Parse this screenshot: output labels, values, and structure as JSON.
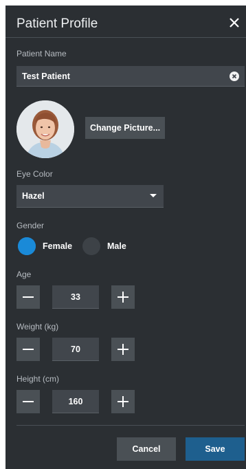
{
  "dialog": {
    "title": "Patient Profile",
    "close_icon": "close-icon"
  },
  "patient_name": {
    "label": "Patient Name",
    "value": "Test Patient",
    "clear_icon": "clear-circle-icon"
  },
  "picture": {
    "change_label": "Change Picture..."
  },
  "eye_color": {
    "label": "Eye Color",
    "selected": "Hazel"
  },
  "gender": {
    "label": "Gender",
    "options": [
      {
        "label": "Female",
        "selected": true
      },
      {
        "label": "Male",
        "selected": false
      }
    ]
  },
  "steppers": {
    "age": {
      "label": "Age",
      "value": "33"
    },
    "weight": {
      "label": "Weight (kg)",
      "value": "70"
    },
    "height": {
      "label": "Height (cm)",
      "value": "160"
    }
  },
  "footer": {
    "cancel_label": "Cancel",
    "save_label": "Save"
  },
  "colors": {
    "panel_bg": "#2b2f33",
    "field_bg": "#41464c",
    "button_bg": "#4a5055",
    "accent": "#1a8ad8",
    "save_bg": "#1e5f8e"
  }
}
